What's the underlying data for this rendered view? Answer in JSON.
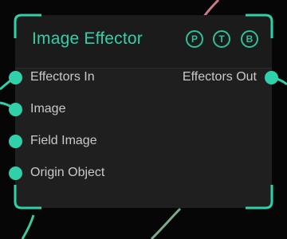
{
  "node": {
    "title": "Image Effector",
    "flags": [
      {
        "label": "P"
      },
      {
        "label": "T"
      },
      {
        "label": "B"
      }
    ],
    "inputs": [
      {
        "label": "Effectors In",
        "connected": true
      },
      {
        "label": "Image",
        "connected": true
      },
      {
        "label": "Field Image",
        "connected": false
      },
      {
        "label": "Origin Object",
        "connected": false
      }
    ],
    "outputs": [
      {
        "label": "Effectors Out",
        "connected": true
      }
    ],
    "colors": {
      "accent": "#2fd1aa",
      "title": "#33cfa8",
      "body": "#1f1f1f",
      "label": "#c9c9c9"
    }
  }
}
